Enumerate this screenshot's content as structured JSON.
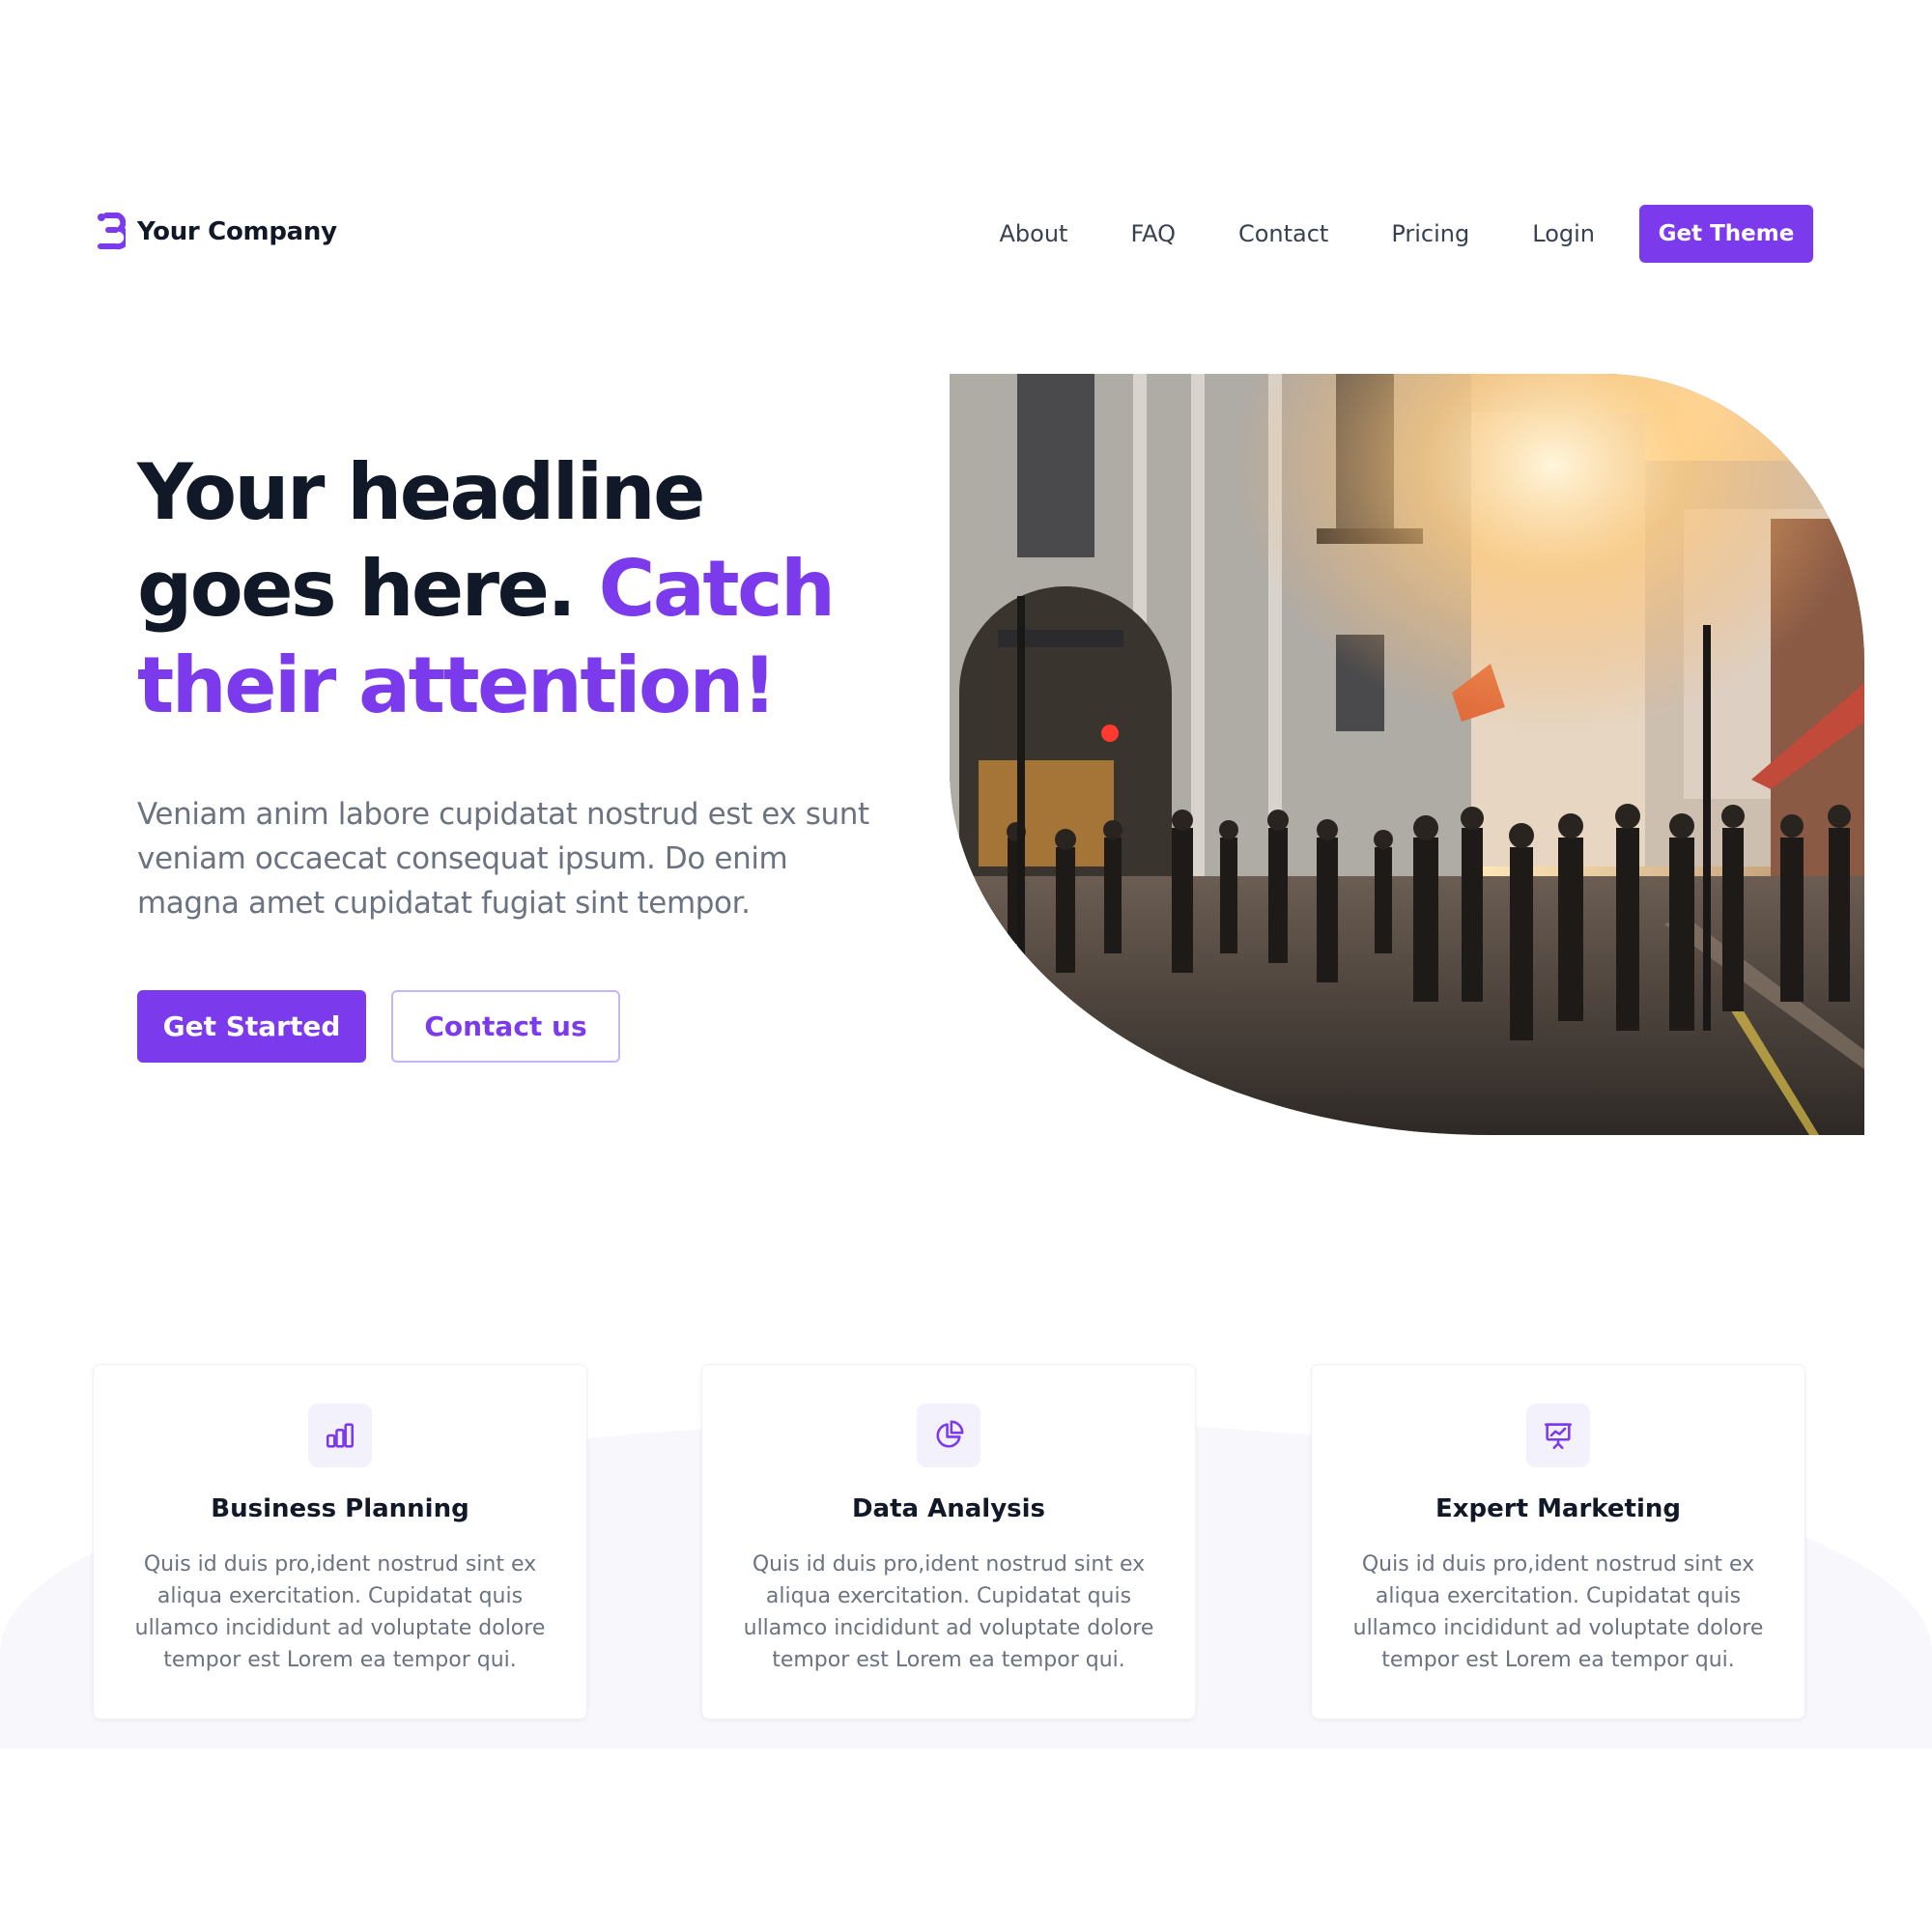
{
  "brand": {
    "name": "Your Company",
    "accent_color": "#7c3aed",
    "logo_icon": "brand-logo-icon"
  },
  "nav": {
    "links": [
      "About",
      "FAQ",
      "Contact",
      "Pricing",
      "Login"
    ],
    "cta_label": "Get Theme"
  },
  "hero": {
    "headline_dark": "Your headline goes here.",
    "headline_accent": "Catch their attention!",
    "lead": "Veniam anim labore cupidatat nostrud est ex sunt veniam occaecat consequat ipsum. Do enim magna amet cupidatat fugiat sint tempor.",
    "primary_button": "Get Started",
    "secondary_button": "Contact us",
    "image_subject": "city-street-photo"
  },
  "features": [
    {
      "icon": "bar-chart-icon",
      "title": "Business Planning",
      "text": "Quis id duis pro,ident nostrud sint ex aliqua exercitation. Cupidatat quis ullamco incididunt ad voluptate dolore tempor est Lorem ea tempor qui."
    },
    {
      "icon": "pie-chart-icon",
      "title": "Data Analysis",
      "text": "Quis id duis pro,ident nostrud sint ex aliqua exercitation. Cupidatat quis ullamco incididunt ad voluptate dolore tempor est Lorem ea tempor qui."
    },
    {
      "icon": "presentation-chart-icon",
      "title": "Expert Marketing",
      "text": "Quis id duis pro,ident nostrud sint ex aliqua exercitation. Cupidatat quis ullamco incididunt ad voluptate dolore tempor est Lorem ea tempor qui."
    }
  ]
}
